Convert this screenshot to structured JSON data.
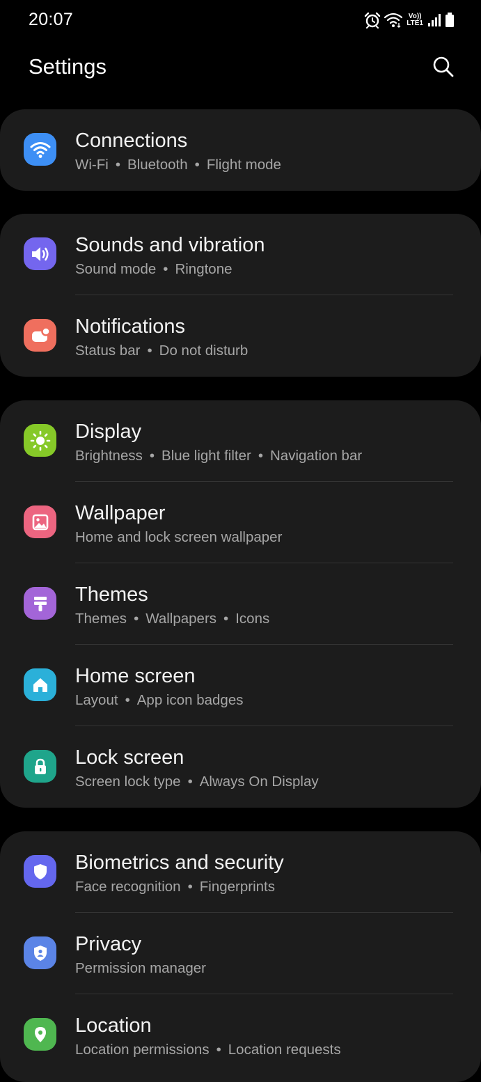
{
  "status_bar": {
    "time": "20:07",
    "volte_top": "Vo))",
    "volte_bottom": "LTE1"
  },
  "header": {
    "title": "Settings"
  },
  "colors": {
    "background": "#000000",
    "card": "#1c1c1c",
    "divider": "#343434",
    "connections": "#3d8ff5",
    "sounds": "#7466ee",
    "notifications": "#ef6f5e",
    "display": "#86c928",
    "wallpaper": "#ec6580",
    "themes": "#a365d8",
    "home_screen": "#2bb0d9",
    "lock_screen": "#1fa58b",
    "biometrics": "#6467ee",
    "privacy": "#5b84e6",
    "location": "#4fb750"
  },
  "groups": [
    {
      "items": [
        {
          "title": "Connections",
          "icon": "wifi-icon",
          "sub": [
            "Wi-Fi",
            "Bluetooth",
            "Flight mode"
          ]
        }
      ]
    },
    {
      "items": [
        {
          "title": "Sounds and vibration",
          "icon": "speaker-icon",
          "sub": [
            "Sound mode",
            "Ringtone"
          ]
        },
        {
          "title": "Notifications",
          "icon": "notification-icon",
          "sub": [
            "Status bar",
            "Do not disturb"
          ]
        }
      ]
    },
    {
      "items": [
        {
          "title": "Display",
          "icon": "sun-icon",
          "sub": [
            "Brightness",
            "Blue light filter",
            "Navigation bar"
          ]
        },
        {
          "title": "Wallpaper",
          "icon": "picture-icon",
          "sub": [
            "Home and lock screen wallpaper"
          ]
        },
        {
          "title": "Themes",
          "icon": "paintbrush-icon",
          "sub": [
            "Themes",
            "Wallpapers",
            "Icons"
          ]
        },
        {
          "title": "Home screen",
          "icon": "home-icon",
          "sub": [
            "Layout",
            "App icon badges"
          ]
        },
        {
          "title": "Lock screen",
          "icon": "lock-icon",
          "sub": [
            "Screen lock type",
            "Always On Display"
          ]
        }
      ]
    },
    {
      "items": [
        {
          "title": "Biometrics and security",
          "icon": "shield-icon",
          "sub": [
            "Face recognition",
            "Fingerprints"
          ]
        },
        {
          "title": "Privacy",
          "icon": "privacy-shield-icon",
          "sub": [
            "Permission manager"
          ]
        },
        {
          "title": "Location",
          "icon": "location-pin-icon",
          "sub": [
            "Location permissions",
            "Location requests"
          ]
        }
      ]
    }
  ]
}
